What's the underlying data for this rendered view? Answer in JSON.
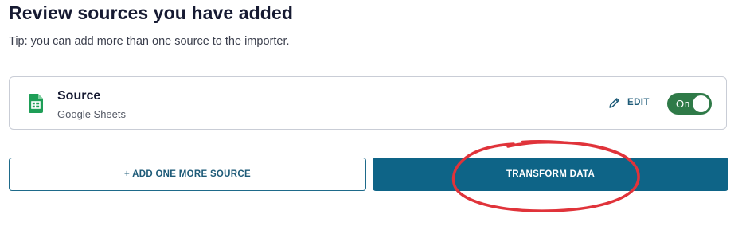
{
  "header": {
    "title": "Review sources you have added",
    "tip": "Tip: you can add more than one source to the importer."
  },
  "source": {
    "name": "Source",
    "type": "Google Sheets",
    "icon": "google-sheets-icon",
    "edit_label": "EDIT",
    "toggle_label": "On",
    "toggle_on": true
  },
  "actions": {
    "add_source_label": "+ ADD ONE MORE SOURCE",
    "transform_label": "TRANSFORM DATA"
  },
  "colors": {
    "primary": "#0e6487",
    "toggle_on": "#2f7a48",
    "annotation": "#e0333a",
    "sheets_green": "#1e9e57"
  }
}
